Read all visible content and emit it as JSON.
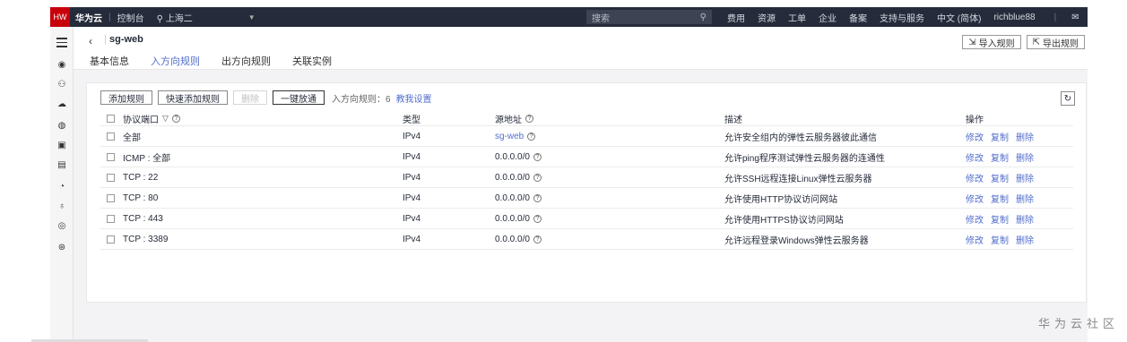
{
  "topbar": {
    "logo_text": "HW",
    "brand": "华为云",
    "console": "控制台",
    "region": "上海二",
    "search_placeholder": "搜索",
    "nav": [
      "费用",
      "资源",
      "工单",
      "企业",
      "备案",
      "支持与服务",
      "中文 (简体)",
      "richblue88"
    ]
  },
  "page": {
    "title": "sg-web",
    "tabs": [
      "基本信息",
      "入方向规则",
      "出方向规则",
      "关联实例"
    ],
    "import_btn": "导入规则",
    "export_btn": "导出规则"
  },
  "toolbar": {
    "add_rule": "添加规则",
    "quick_add": "快速添加规则",
    "delete": "删除",
    "one_click": "一键放通",
    "count_label": "入方向规则：6",
    "teach_link": "教我设置"
  },
  "table": {
    "headers": {
      "protocol_port": "协议端口",
      "type": "类型",
      "source": "源地址",
      "desc": "描述",
      "ops": "操作"
    },
    "ops": {
      "edit": "修改",
      "copy": "复制",
      "delete": "删除"
    },
    "rows": [
      {
        "protocol_port": "全部",
        "type": "IPv4",
        "source": "sg-web",
        "desc": "允许安全组内的弹性云服务器彼此通信"
      },
      {
        "protocol_port": "ICMP : 全部",
        "type": "IPv4",
        "source": "0.0.0.0/0",
        "desc": "允许ping程序测试弹性云服务器的连通性"
      },
      {
        "protocol_port": "TCP : 22",
        "type": "IPv4",
        "source": "0.0.0.0/0",
        "desc": "允许SSH远程连接Linux弹性云服务器"
      },
      {
        "protocol_port": "TCP : 80",
        "type": "IPv4",
        "source": "0.0.0.0/0",
        "desc": "允许使用HTTP协议访问网站"
      },
      {
        "protocol_port": "TCP : 443",
        "type": "IPv4",
        "source": "0.0.0.0/0",
        "desc": "允许使用HTTPS协议访问网站"
      },
      {
        "protocol_port": "TCP : 3389",
        "type": "IPv4",
        "source": "0.0.0.0/0",
        "desc": "允许远程登录Windows弹性云服务器"
      }
    ]
  },
  "watermark": "华为云社区"
}
